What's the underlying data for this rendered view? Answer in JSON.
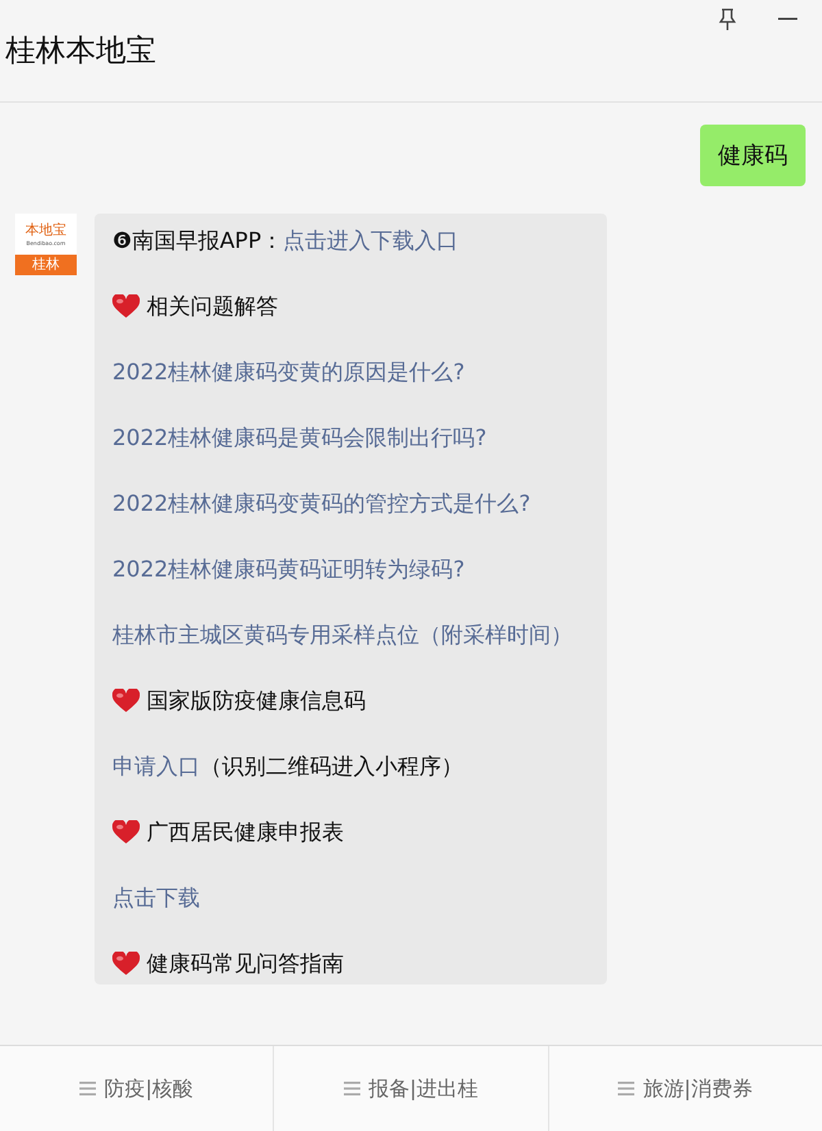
{
  "window": {
    "title": "桂林本地宝"
  },
  "outgoing": {
    "text": "健康码"
  },
  "avatar": {
    "brand": "本地宝",
    "site": "Bendibao.com",
    "city": "桂林"
  },
  "message": [
    {
      "kind": "line",
      "segments": [
        {
          "text": "❻南国早报APP：",
          "link": false
        },
        {
          "text": "点击进入下载入口",
          "link": true
        }
      ]
    },
    {
      "kind": "heading",
      "text": "相关问题解答"
    },
    {
      "kind": "link",
      "text": "2022桂林健康码变黄的原因是什么?"
    },
    {
      "kind": "link",
      "text": "2022桂林健康码是黄码会限制出行吗?"
    },
    {
      "kind": "link",
      "text": "2022桂林健康码变黄码的管控方式是什么?"
    },
    {
      "kind": "link",
      "text": "2022桂林健康码黄码证明转为绿码?"
    },
    {
      "kind": "line",
      "segments": [
        {
          "text": "桂林市主城区黄码专用采样点位（附采样时间）",
          "link": true
        }
      ]
    },
    {
      "kind": "heading",
      "text": "国家版防疫健康信息码"
    },
    {
      "kind": "line",
      "segments": [
        {
          "text": "申请入口",
          "link": true
        },
        {
          "text": "（识别二维码进入小程序）",
          "link": false
        }
      ]
    },
    {
      "kind": "heading",
      "text": "广西居民健康申报表"
    },
    {
      "kind": "link",
      "text": "点击下载"
    },
    {
      "kind": "heading",
      "text": "健康码常见问答指南"
    }
  ],
  "menu": [
    {
      "label": "防疫|核酸"
    },
    {
      "label": "报备|进出桂"
    },
    {
      "label": "旅游|消费券"
    }
  ]
}
